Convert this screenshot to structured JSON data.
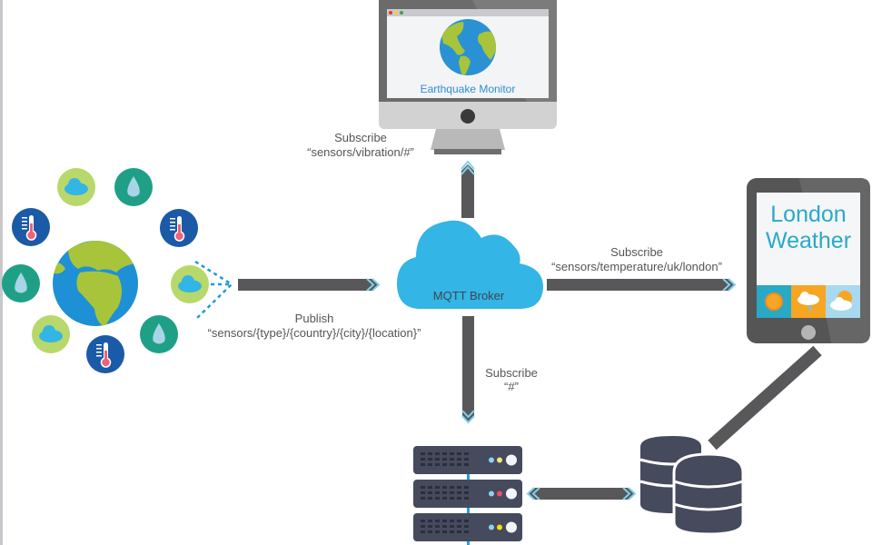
{
  "monitor": {
    "title": "Earthquake Monitor"
  },
  "broker": {
    "label": "MQTT Broker"
  },
  "publish": {
    "label": "Publish",
    "topic": "“sensors/{type}/{country}/{city}/{location}”"
  },
  "subscribe_monitor": {
    "label": "Subscribe",
    "topic": "“sensors/vibration/#”"
  },
  "subscribe_tablet": {
    "label": "Subscribe",
    "topic": "“sensors/temperature/uk/london”"
  },
  "subscribe_server": {
    "label": "Subscribe",
    "topic": "“#”"
  },
  "tablet": {
    "line1": "London",
    "line2": "Weather",
    "tiles": [
      "sun-icon",
      "cloud-rain-icon",
      "sun-cloud-icon"
    ]
  },
  "sensors": [
    "cloud",
    "drop",
    "thermometer",
    "thermometer",
    "drop",
    "cloud",
    "cloud",
    "thermometer",
    "drop"
  ],
  "colors": {
    "arrow": "#58585a",
    "accent": "#33b5e5",
    "globe_water": "#1e90d6",
    "globe_land": "#a8c43a",
    "server": "#454a5c",
    "text_blue": "#2b8fd1",
    "tablet_text": "#2aa9c8"
  }
}
